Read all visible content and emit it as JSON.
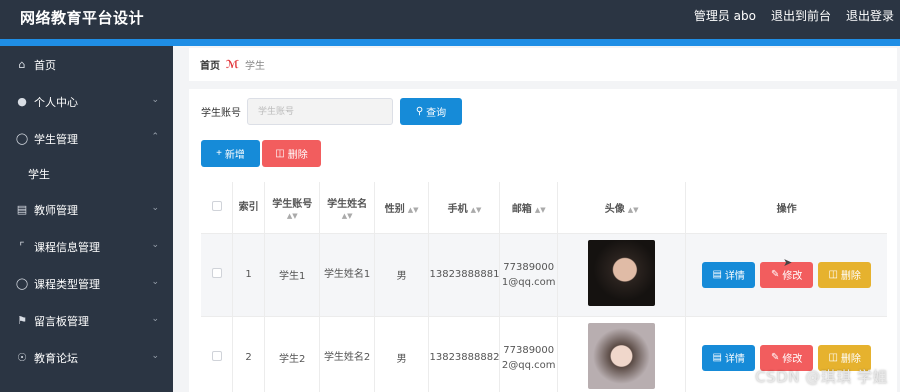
{
  "header": {
    "title": "网络教育平台设计",
    "nav": {
      "admin": "管理员 abo",
      "front": "退出到前台",
      "logout": "退出登录"
    }
  },
  "sidebar": {
    "items": [
      {
        "label": "首页",
        "icon": "home-icon"
      },
      {
        "label": "个人中心",
        "icon": "user-icon"
      },
      {
        "label": "学生管理",
        "icon": "mic-icon",
        "expanded": true
      },
      {
        "label": "学生",
        "sub": true
      },
      {
        "label": "教师管理",
        "icon": "doc-icon"
      },
      {
        "label": "课程信息管理",
        "icon": "crop-icon"
      },
      {
        "label": "课程类型管理",
        "icon": "mic-icon"
      },
      {
        "label": "留言板管理",
        "icon": "flag-icon"
      },
      {
        "label": "教育论坛",
        "icon": "compass-icon"
      }
    ]
  },
  "breadcrumb": {
    "home": "首页",
    "current": "学生"
  },
  "search": {
    "label": "学生账号",
    "placeholder": "学生账号",
    "button": "查询"
  },
  "toolbar": {
    "add": "新增",
    "delete": "删除"
  },
  "table": {
    "headers": {
      "index": "索引",
      "account": "学生账号",
      "name": "学生姓名",
      "gender": "性别",
      "phone": "手机",
      "email": "邮箱",
      "avatar": "头像",
      "actions": "操作"
    },
    "rows": [
      {
        "index": "1",
        "account": "学生1",
        "name": "学生姓名1",
        "gender": "男",
        "phone": "13823888881",
        "email": "773890001@qq.com"
      },
      {
        "index": "2",
        "account": "学生2",
        "name": "学生姓名2",
        "gender": "男",
        "phone": "13823888882",
        "email": "773890002@qq.com"
      }
    ],
    "row_actions": {
      "detail": "详情",
      "edit": "修改",
      "delete": "删除"
    }
  },
  "watermark": "CSDN @琪琪 学姐",
  "colors": {
    "primary": "#168bd8",
    "danger": "#f25d5e",
    "warning": "#e6b22e",
    "sidebar": "#2b3543"
  }
}
